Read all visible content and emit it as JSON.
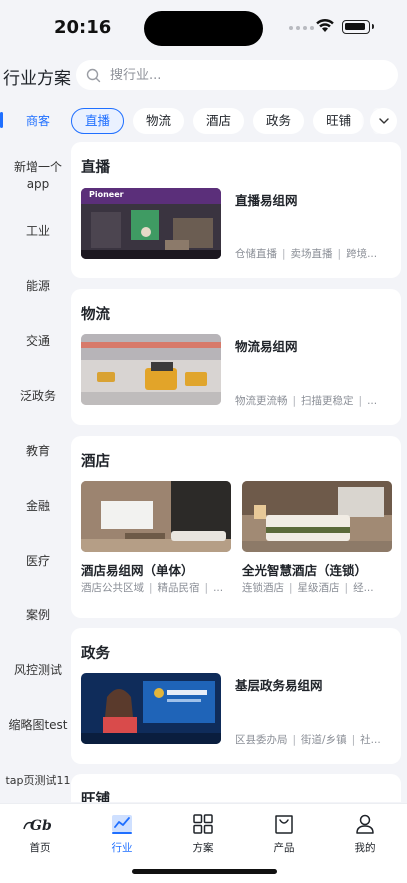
{
  "status": {
    "time": "20:16"
  },
  "header": {
    "title": "行业方案"
  },
  "search": {
    "placeholder": "搜行业..."
  },
  "sidebar": {
    "items": [
      {
        "label": "商客",
        "active": true
      },
      {
        "label": "新增一个app"
      },
      {
        "label": "工业"
      },
      {
        "label": "能源"
      },
      {
        "label": "交通"
      },
      {
        "label": "泛政务"
      },
      {
        "label": "教育"
      },
      {
        "label": "金融"
      },
      {
        "label": "医疗"
      },
      {
        "label": "案例"
      },
      {
        "label": "风控测试"
      },
      {
        "label": "缩略图test"
      },
      {
        "label": "tap页测试11"
      }
    ]
  },
  "chips": {
    "items": [
      {
        "label": "直播",
        "active": true
      },
      {
        "label": "物流"
      },
      {
        "label": "酒店"
      },
      {
        "label": "政务"
      },
      {
        "label": "旺铺"
      }
    ]
  },
  "sections": [
    {
      "title": "直播",
      "items": [
        {
          "name": "直播易组网",
          "tags": [
            "仓储直播",
            "卖场直播",
            "跨境..."
          ],
          "thumb_text": "Pioneer"
        }
      ]
    },
    {
      "title": "物流",
      "items": [
        {
          "name": "物流易组网",
          "tags": [
            "物流更流畅",
            "扫描更稳定",
            "..."
          ]
        }
      ]
    },
    {
      "title": "酒店",
      "items": [
        {
          "name": "酒店易组网（单体）",
          "tags": [
            "酒店公共区域",
            "精品民宿",
            "..."
          ]
        },
        {
          "name": "全光智慧酒店（连锁）",
          "tags": [
            "连锁酒店",
            "星级酒店",
            "经..."
          ]
        }
      ]
    },
    {
      "title": "政务",
      "items": [
        {
          "name": "基层政务易组网",
          "tags": [
            "区县委办局",
            "街道/乡镇",
            "社..."
          ]
        }
      ]
    },
    {
      "title": "旺铺",
      "items": []
    }
  ],
  "tabbar": {
    "items": [
      {
        "label": "首页",
        "icon": "home-logo-icon"
      },
      {
        "label": "行业",
        "icon": "industry-chart-icon",
        "active": true
      },
      {
        "label": "方案",
        "icon": "grid-icon"
      },
      {
        "label": "产品",
        "icon": "bag-icon"
      },
      {
        "label": "我的",
        "icon": "user-icon"
      }
    ]
  },
  "colors": {
    "accent": "#1f6fff",
    "background": "#f3f4f8",
    "card": "#ffffff"
  }
}
